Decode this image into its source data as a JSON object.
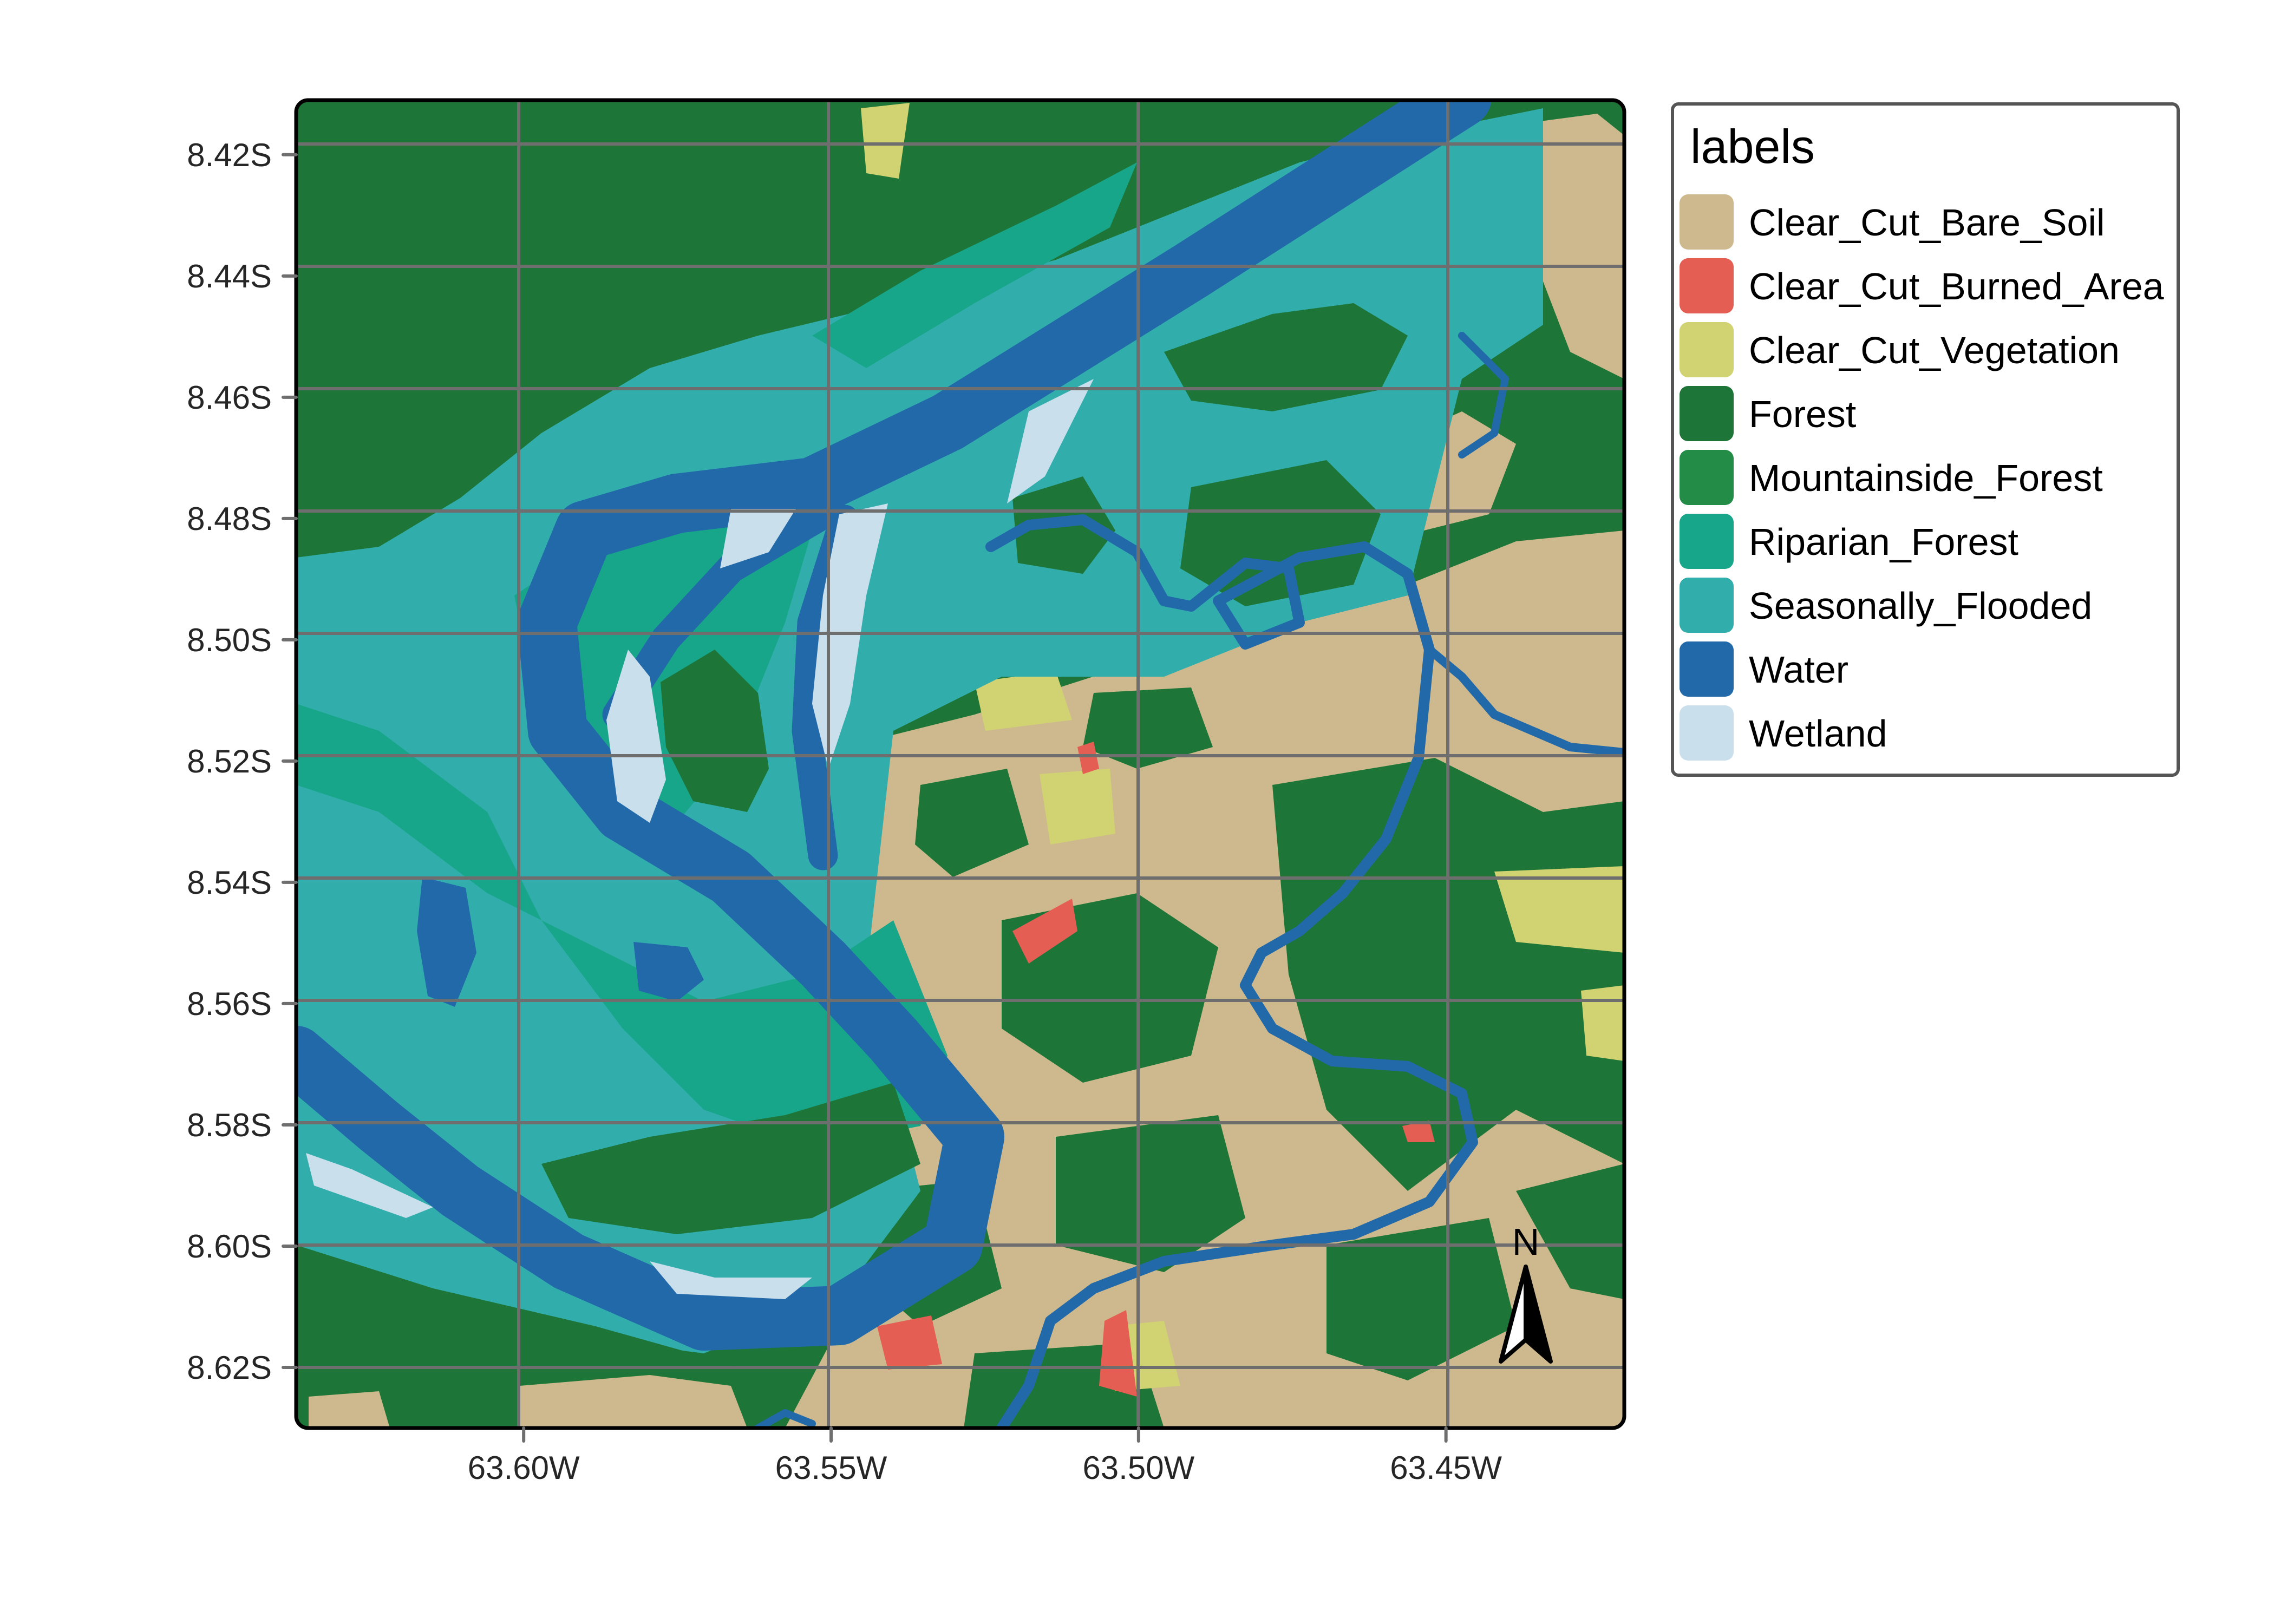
{
  "figure": {
    "type": "landcover classification map",
    "legend": {
      "title": "labels",
      "items": [
        {
          "label": "Clear_Cut_Bare_Soil",
          "color": "#CDB98D"
        },
        {
          "label": "Clear_Cut_Burned_Area",
          "color": "#E45E53"
        },
        {
          "label": "Clear_Cut_Vegetation",
          "color": "#D1D373"
        },
        {
          "label": "Forest",
          "color": "#1D7537"
        },
        {
          "label": "Mountainside_Forest",
          "color": "#238C47"
        },
        {
          "label": "Riparian_Forest",
          "color": "#17A68A"
        },
        {
          "label": "Seasonally_Flooded",
          "color": "#31AEAC"
        },
        {
          "label": "Water",
          "color": "#2269A9"
        },
        {
          "label": "Wetland",
          "color": "#CADFEC"
        }
      ]
    },
    "axes": {
      "y_ticks": [
        "8.42S",
        "8.44S",
        "8.46S",
        "8.48S",
        "8.50S",
        "8.52S",
        "8.54S",
        "8.56S",
        "8.58S",
        "8.60S",
        "8.62S"
      ],
      "x_ticks": [
        "63.60W",
        "63.55W",
        "63.50W",
        "63.45W"
      ],
      "gridline_color": "#6E6E6E",
      "tick_label_color": "#262626"
    },
    "north_arrow": {
      "label": "N"
    }
  },
  "chart_data": {
    "type": "heatmap",
    "title": "",
    "xlabel": "",
    "ylabel": "",
    "legend_title": "labels",
    "legend_placement": "right",
    "classes": [
      "Clear_Cut_Bare_Soil",
      "Clear_Cut_Burned_Area",
      "Clear_Cut_Vegetation",
      "Forest",
      "Mountainside_Forest",
      "Riparian_Forest",
      "Seasonally_Flooded",
      "Water",
      "Wetland"
    ],
    "x_ticks_deg": [
      -63.6,
      -63.55,
      -63.5,
      -63.45
    ],
    "x_tick_labels": [
      "63.60W",
      "63.55W",
      "63.50W",
      "63.45W"
    ],
    "y_ticks_deg": [
      -8.42,
      -8.44,
      -8.46,
      -8.48,
      -8.5,
      -8.52,
      -8.54,
      -8.56,
      -8.58,
      -8.6,
      -8.62
    ],
    "y_tick_labels": [
      "8.42S",
      "8.44S",
      "8.46S",
      "8.48S",
      "8.50S",
      "8.52S",
      "8.54S",
      "8.56S",
      "8.58S",
      "8.60S",
      "8.62S"
    ],
    "xlim": [
      -63.637,
      -63.421
    ],
    "ylim": [
      -8.63,
      -8.411
    ],
    "grid": true
  }
}
